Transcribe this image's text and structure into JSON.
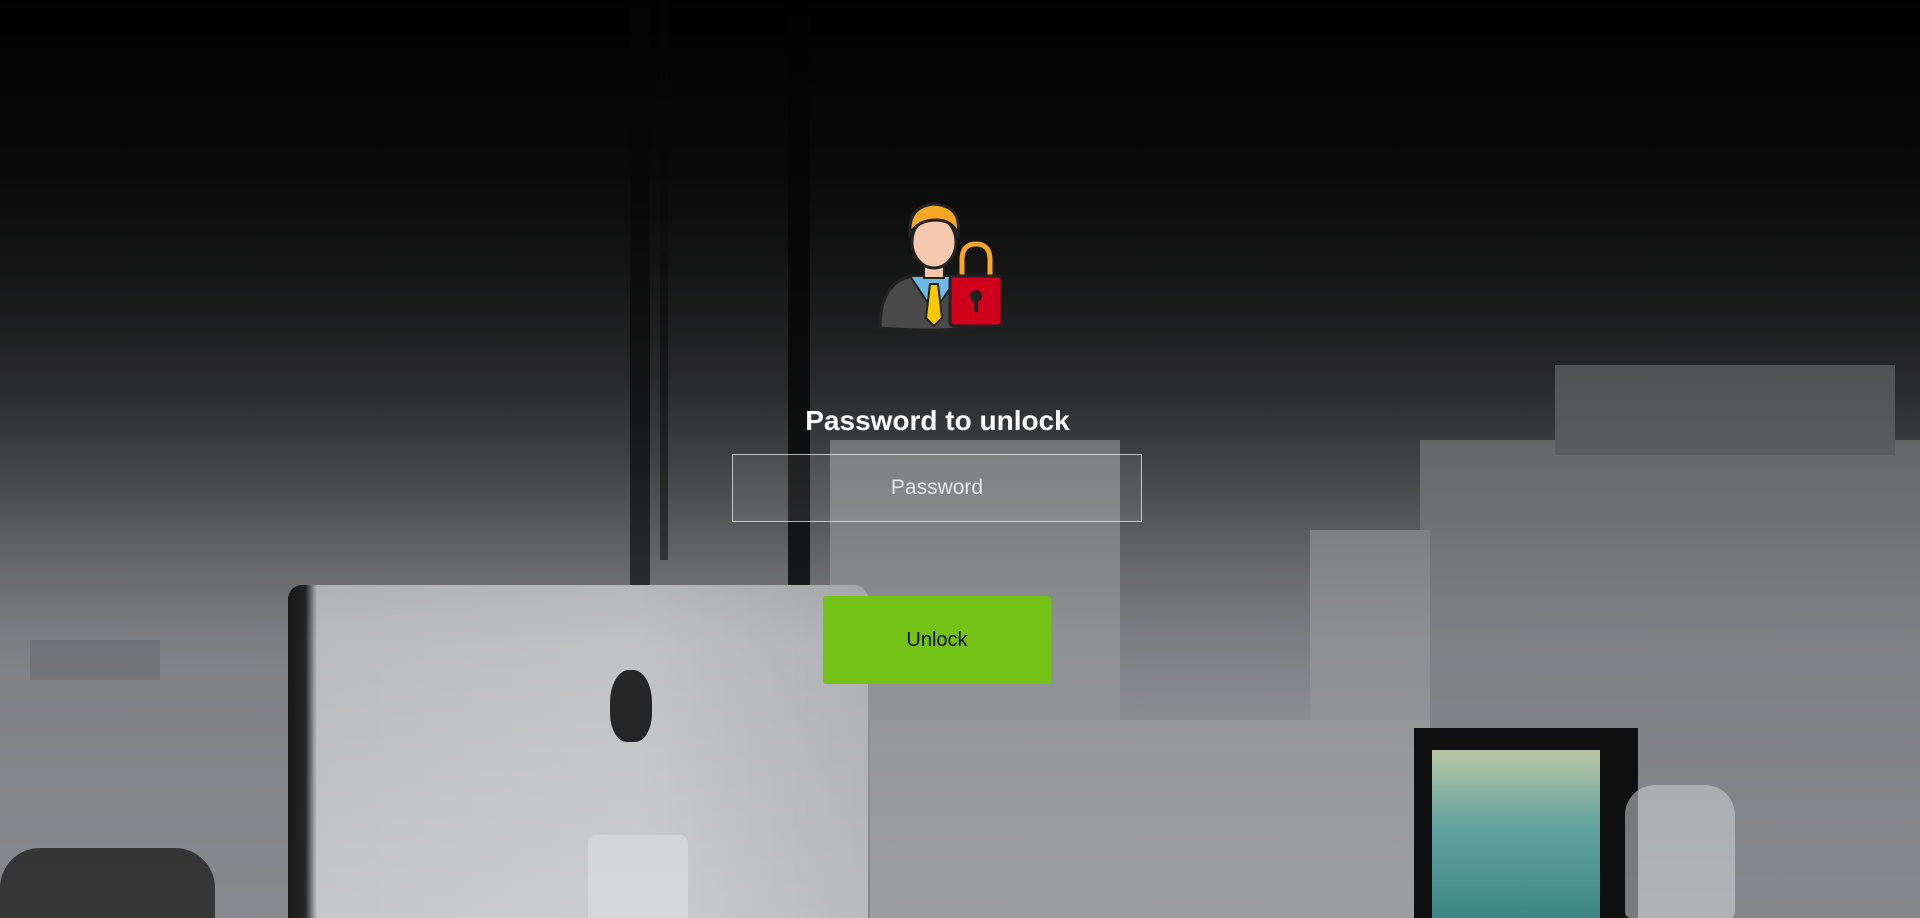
{
  "lock_screen": {
    "title": "Password to unlock",
    "password_placeholder": "Password",
    "password_value": "",
    "unlock_label": "Unlock",
    "avatar_icon": "user-lock-icon"
  },
  "colors": {
    "accent": "#72c316",
    "title_text": "#ffffff",
    "lock_red": "#d0021b",
    "hair_orange": "#f5a623",
    "tie_yellow": "#f8c800"
  }
}
